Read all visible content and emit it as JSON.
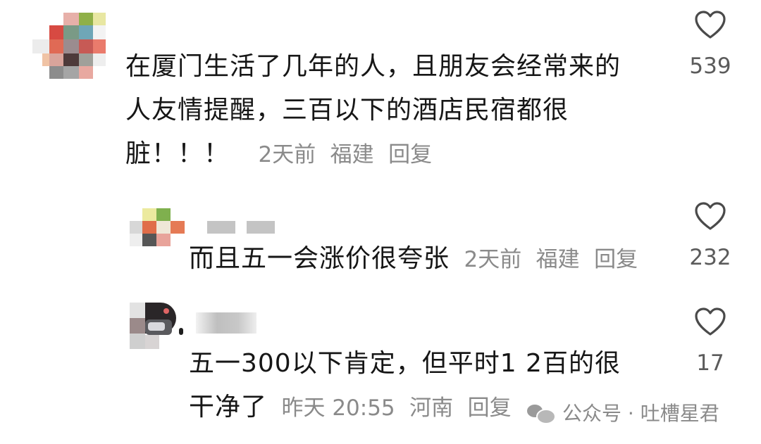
{
  "comments": [
    {
      "line1": "在厦门生活了几年的人，且朋友会经常来的",
      "line2": "人友情提醒，三百以下的酒店民宿都很",
      "line3": "脏！！！",
      "time": "2天前",
      "location": "福建",
      "reply": "回复",
      "likes": "539"
    },
    {
      "line1": "而且五一会涨价很夸张",
      "time": "2天前",
      "location": "福建",
      "reply": "回复",
      "likes": "232"
    },
    {
      "line1": "五一300以下肯定，但平时1 2百的很",
      "line2": "干净了",
      "time": "昨天 20:55",
      "location": "河南",
      "reply": "回复",
      "likes": "17"
    }
  ],
  "watermark": "公众号 · 吐槽星君",
  "icons": {
    "like": "heart-outline-icon",
    "wechat": "wechat-icon"
  },
  "colors": {
    "text": "#161616",
    "meta": "#8a8a8a",
    "count": "#5b5b5b"
  }
}
